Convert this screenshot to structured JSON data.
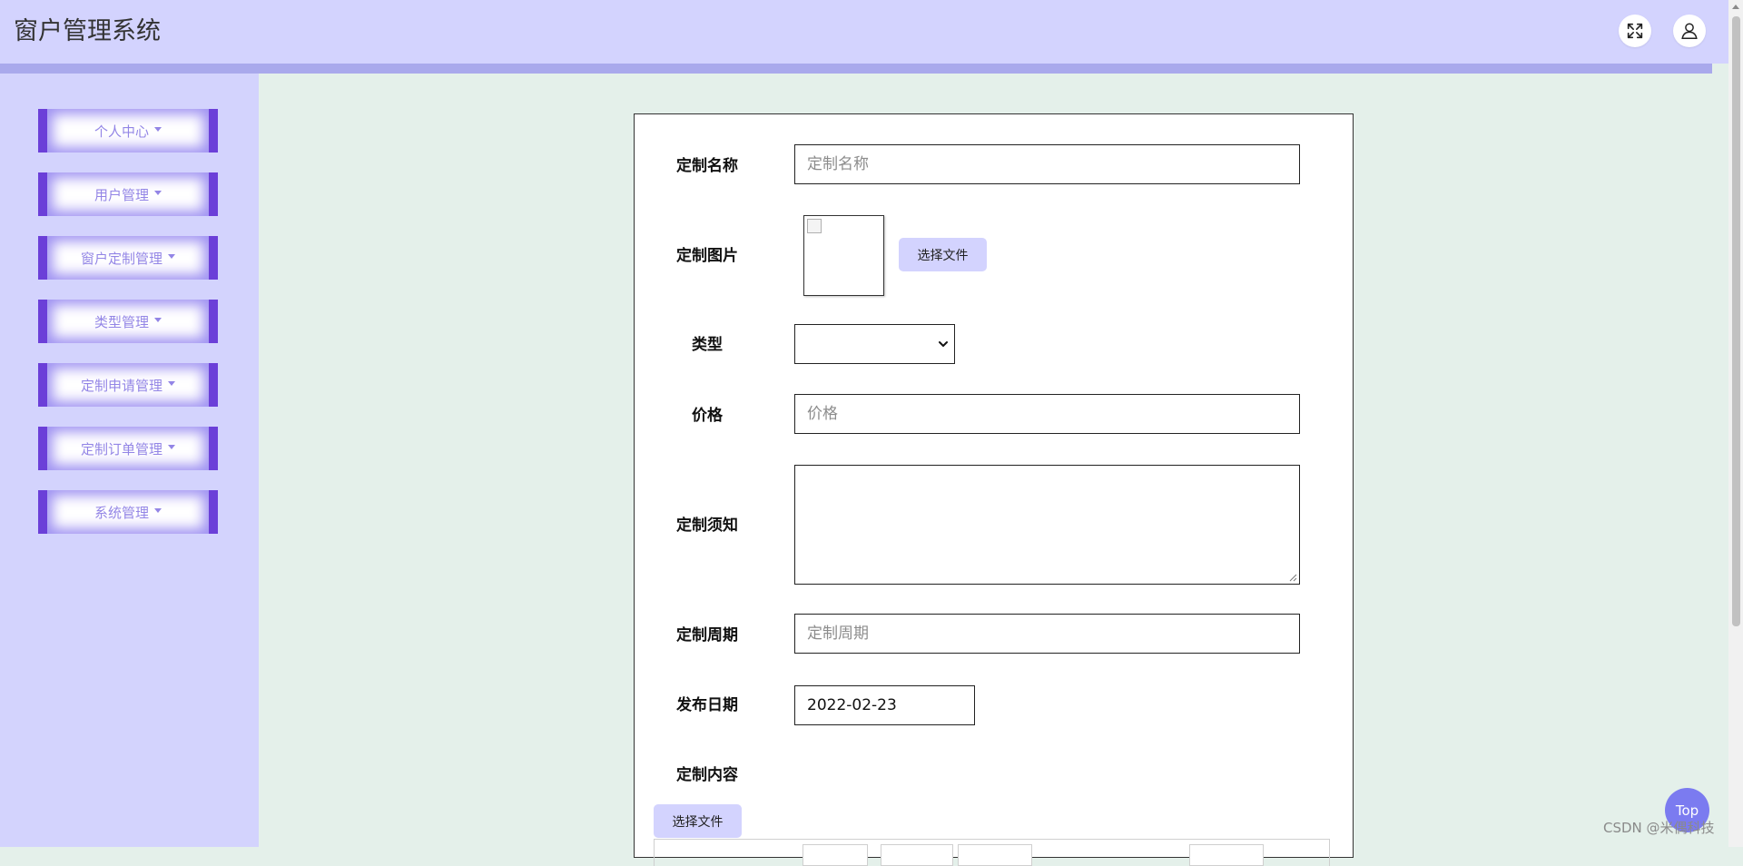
{
  "app": {
    "title": "窗户管理系统"
  },
  "header": {
    "fullscreen_icon": "expand-icon",
    "user_icon": "user-icon"
  },
  "sidebar": {
    "items": [
      {
        "label": "个人中心"
      },
      {
        "label": "用户管理"
      },
      {
        "label": "窗户定制管理"
      },
      {
        "label": "类型管理"
      },
      {
        "label": "定制申请管理"
      },
      {
        "label": "定制订单管理"
      },
      {
        "label": "系统管理"
      }
    ]
  },
  "form": {
    "name": {
      "label": "定制名称",
      "placeholder": "定制名称",
      "value": ""
    },
    "image": {
      "label": "定制图片",
      "button": "选择文件"
    },
    "type": {
      "label": "类型",
      "value": ""
    },
    "price": {
      "label": "价格",
      "placeholder": "价格",
      "value": ""
    },
    "notice": {
      "label": "定制须知",
      "value": ""
    },
    "period": {
      "label": "定制周期",
      "placeholder": "定制周期",
      "value": ""
    },
    "date": {
      "label": "发布日期",
      "value": "2022-02-23"
    },
    "content": {
      "label": "定制内容",
      "button": "选择文件"
    }
  },
  "top_button": {
    "label": "Top"
  },
  "watermark": "CSDN @米偶科技",
  "colors": {
    "header_bg": "#d3d3fe",
    "header_strip": "#a9a9ec",
    "sidebar_bg": "#d3d3fd",
    "sidebar_accent": "#6b3fd8",
    "sidebar_text": "#9385e6",
    "page_bg": "#e4f0ea",
    "button_bg": "#d3d3fe",
    "top_button_bg": "#7b7bf0"
  }
}
